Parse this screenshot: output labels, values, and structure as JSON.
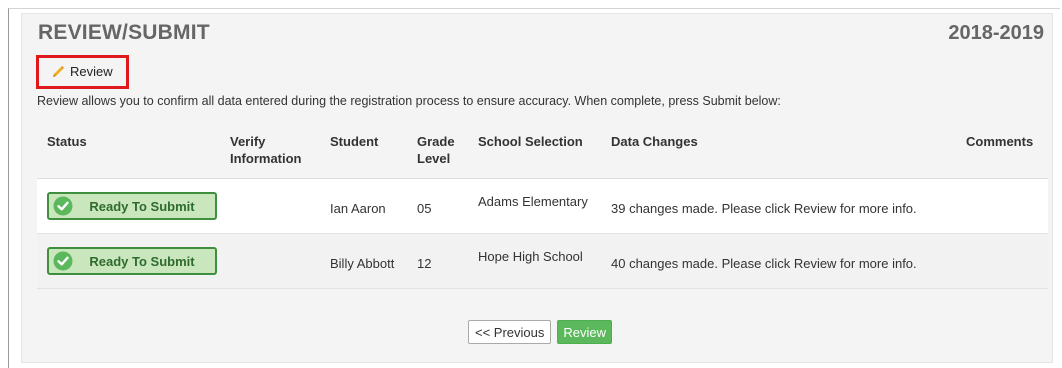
{
  "header": {
    "title": "REVIEW/SUBMIT",
    "school_year": "2018-2019"
  },
  "review_link": {
    "label": "Review",
    "icon": "pencil-icon"
  },
  "instructions": "Review allows you to confirm all data entered during the registration process to ensure accuracy. When complete, press Submit below:",
  "table": {
    "columns": [
      "Status",
      "Verify Information",
      "Student",
      "Grade Level",
      "School Selection",
      "Data Changes",
      "Comments"
    ],
    "rows": [
      {
        "status": "Ready To Submit",
        "verify": "",
        "student": "Ian Aaron",
        "grade": "05",
        "school": "Adams Elementary",
        "changes": "39 changes made. Please click Review for more info.",
        "comments": ""
      },
      {
        "status": "Ready To Submit",
        "verify": "",
        "student": "Billy Abbott",
        "grade": "12",
        "school": "Hope High School",
        "changes": "40 changes made. Please click Review for more info.",
        "comments": ""
      }
    ]
  },
  "pager": {
    "previous_label": "<< Previous",
    "review_label": "Review"
  },
  "colors": {
    "status_fill": "#c9e6bd",
    "status_border": "#3f8f3f",
    "review_button": "#5cb85c",
    "highlight_box": "#e0191c"
  }
}
